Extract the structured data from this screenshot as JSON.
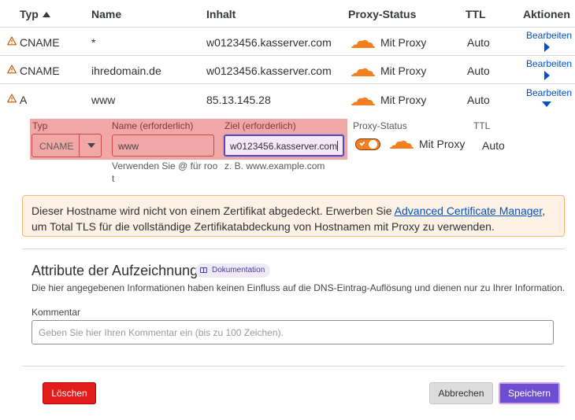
{
  "header": {
    "type": "Typ",
    "name": "Name",
    "content": "Inhalt",
    "proxy_status": "Proxy-Status",
    "ttl": "TTL",
    "actions": "Aktionen"
  },
  "records": [
    {
      "type": "CNAME",
      "name": "*",
      "content": "w0123456.kasserver.com",
      "proxy": "Mit Proxy",
      "ttl": "Auto",
      "action": "Bearbeiten"
    },
    {
      "type": "CNAME",
      "name": "ihredomain.de",
      "content": "w0123456.kasserver.com",
      "proxy": "Mit Proxy",
      "ttl": "Auto",
      "action": "Bearbeiten"
    },
    {
      "type": "A",
      "name": "www",
      "content": "85.13.145.28",
      "proxy": "Mit Proxy",
      "ttl": "Auto",
      "action": "Bearbeiten"
    }
  ],
  "edit_form": {
    "type_label": "Typ",
    "type_value": "CNAME",
    "name_label": "Name (erforderlich)",
    "name_value": "www",
    "name_hint_1": "Verwenden Sie @ für roo",
    "name_hint_2": "t",
    "target_label": "Ziel (erforderlich)",
    "target_value": "w0123456.kasserver.com",
    "target_hint": "z. B. www.example.com",
    "proxy_label": "Proxy-Status",
    "proxy_value": "Mit Proxy",
    "ttl_label": "TTL",
    "ttl_value": "Auto"
  },
  "notice": {
    "text_before": "Dieser Hostname wird nicht von einem Zertifikat abgedeckt. Erwerben Sie ",
    "link": "Advanced Certificate Manager",
    "text_after": ", um Total TLS für die vollständige Zertifikatabdeckung von Hostnamen mit Proxy zu verwenden."
  },
  "attributes": {
    "title": "Attribute der Aufzeichnung",
    "doc_badge": "Dokumentation",
    "description": "Die hier angegebenen Informationen haben keinen Einfluss auf die DNS-Eintrag-Auflösung und dienen nur zu Ihrer Information.",
    "comment_label": "Kommentar",
    "comment_placeholder": "Geben Sie hier Ihren Kommentar ein (bis zu 100 Zeichen)."
  },
  "buttons": {
    "delete": "Löschen",
    "cancel": "Abbrechen",
    "save": "Speichern"
  },
  "colors": {
    "proxy_orange": "#f38020",
    "link_blue": "#0051c3",
    "error_bg": "#f2a7a7",
    "save_purple": "#6c4fd1",
    "delete_red": "#e21b1b"
  },
  "icons": {
    "warning": "warning-triangle-icon",
    "proxy": "orange-cloud-icon",
    "expand": "caret-right-icon",
    "collapse": "caret-down-icon",
    "docs": "book-icon"
  }
}
